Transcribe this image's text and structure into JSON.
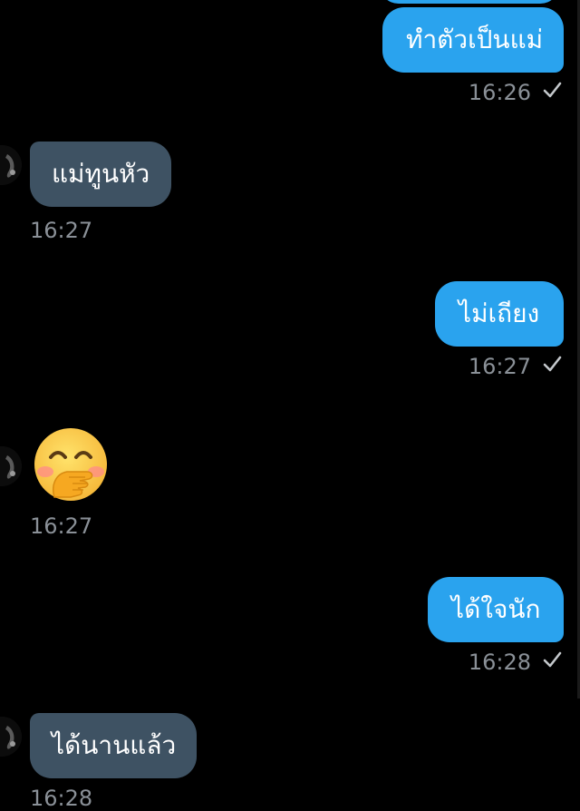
{
  "colors": {
    "background": "#000000",
    "outgoing_bubble": "#2aa3ee",
    "incoming_bubble": "#3e5263",
    "timestamp": "#8a9097"
  },
  "messages": [
    {
      "direction": "out",
      "text": "ทำตัวเป็นแม่",
      "time": "16:26",
      "status_icon": "check-icon"
    },
    {
      "direction": "in",
      "text": "แม่ทูนหัว",
      "time": "16:27"
    },
    {
      "direction": "out",
      "text": "ไม่เถียง",
      "time": "16:27",
      "status_icon": "check-icon"
    },
    {
      "direction": "in",
      "emoji": "face-with-hand-over-mouth-emoji",
      "time": "16:27"
    },
    {
      "direction": "out",
      "text": "ได้ใจนัก",
      "time": "16:28",
      "status_icon": "check-icon"
    },
    {
      "direction": "in",
      "text": "ได้นานแล้ว",
      "time": "16:28"
    }
  ]
}
